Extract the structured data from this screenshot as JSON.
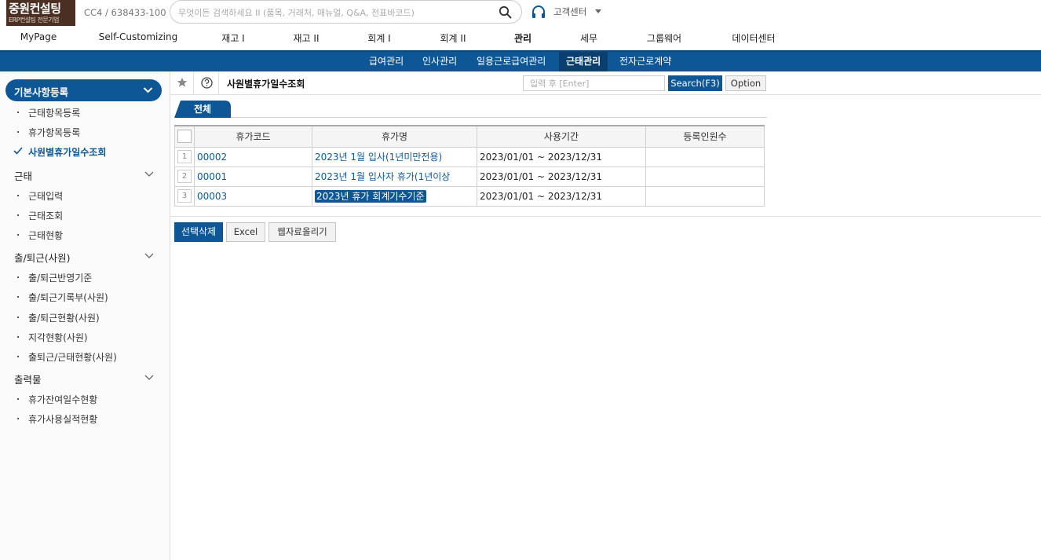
{
  "brand": {
    "name": "중원컨설팅",
    "tagline": "ERP컨설팅 전문기업"
  },
  "company_code": "CC4 / 638433-100",
  "search": {
    "placeholder": "무엇이든 검색하세요 II (품목, 거래처, 매뉴얼, Q&A, 전표바코드)"
  },
  "support": {
    "label": "고객센터"
  },
  "main_nav": [
    "MyPage",
    "Self-Customizing",
    "재고 I",
    "재고 II",
    "회계 I",
    "회계 II",
    "관리",
    "세무",
    "그룹웨어",
    "데이터센터"
  ],
  "main_nav_active": "관리",
  "sub_nav": [
    "급여관리",
    "인사관리",
    "일용근로급여관리",
    "근태관리",
    "전자근로계약"
  ],
  "sub_nav_active": "근태관리",
  "sidebar": {
    "sections": [
      {
        "title": "기본사항등록",
        "items": [
          "근태항목등록",
          "휴가항목등록",
          "사원별휴가일수조회"
        ]
      },
      {
        "title": "근태",
        "items": [
          "근태입력",
          "근태조회",
          "근태현황"
        ]
      },
      {
        "title": "출/퇴근(사원)",
        "items": [
          "출/퇴근반영기준",
          "출/퇴근기록부(사원)",
          "출/퇴근현황(사원)",
          "지각현황(사원)",
          "출퇴근/근태현황(사원)"
        ]
      },
      {
        "title": "출력물",
        "items": [
          "휴가잔여일수현황",
          "휴가사용실적현황"
        ]
      }
    ],
    "current_item": "사원별휴가일수조회"
  },
  "page": {
    "title": "사원별휴가일수조회",
    "search_placeholder": "입력 후 [Enter]",
    "search_button": "Search(F3)",
    "option_button": "Option",
    "tab": "전체"
  },
  "table": {
    "columns": [
      "휴가코드",
      "휴가명",
      "사용기간",
      "등록인원수"
    ],
    "rows": [
      {
        "no": "1",
        "code": "00002",
        "name": "2023년 1월 입사(1년미만전용)",
        "period": "2023/01/01 ~ 2023/12/31",
        "count": ""
      },
      {
        "no": "2",
        "code": "00001",
        "name": "2023년 1월 입사자 휴가(1년이상",
        "period": "2023/01/01 ~ 2023/12/31",
        "count": ""
      },
      {
        "no": "3",
        "code": "00003",
        "name": "2023년 휴가 회계기수기준",
        "period": "2023/01/01 ~ 2023/12/31",
        "count": ""
      }
    ],
    "selected_row": 3
  },
  "actions": {
    "delete": "선택삭제",
    "excel": "Excel",
    "upload": "웹자료올리기"
  },
  "colors": {
    "accent": "#0e5796",
    "logo_bg": "#4a2f22"
  },
  "icons": {
    "search": "magnifier-icon",
    "support": "headset-icon",
    "star": "star-icon",
    "help": "question-icon"
  }
}
